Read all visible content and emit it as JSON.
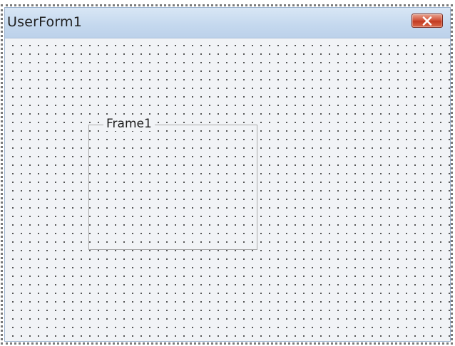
{
  "window": {
    "title": "UserForm1",
    "close_icon": "close-icon",
    "close_color": "#c33b22"
  },
  "frame": {
    "caption": "Frame1"
  }
}
